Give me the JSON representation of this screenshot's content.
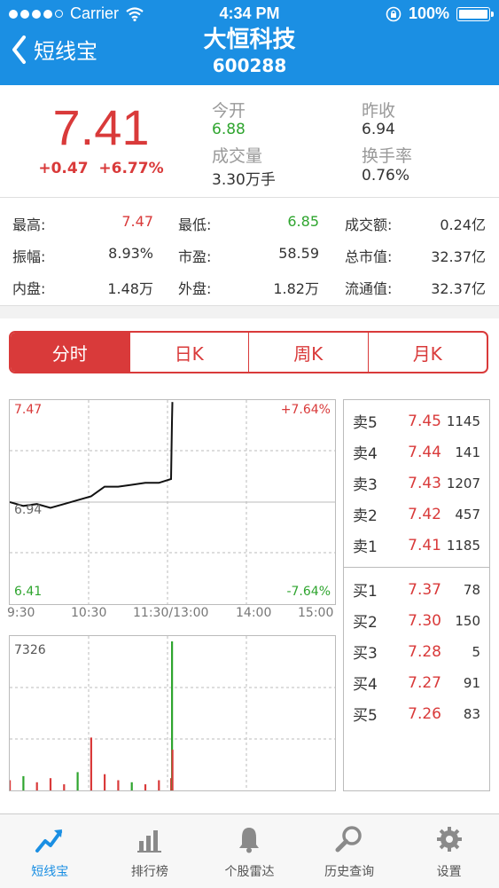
{
  "status": {
    "carrier": "Carrier",
    "time": "4:34 PM",
    "battery": "100%"
  },
  "nav": {
    "back_label": "短线宝",
    "title": "大恒科技",
    "code": "600288"
  },
  "quote": {
    "price": "7.41",
    "change": "+0.47",
    "change_pct": "+6.77%",
    "open_label": "今开",
    "open": "6.88",
    "prev_close_label": "昨收",
    "prev_close": "6.94",
    "volume_label": "成交量",
    "volume": "3.30万手",
    "turnover_label": "换手率",
    "turnover": "0.76%"
  },
  "stats": [
    [
      {
        "label": "最高:",
        "value": "7.47",
        "color": "red"
      },
      {
        "label": "最低:",
        "value": "6.85",
        "color": "green"
      },
      {
        "label": "成交额:",
        "value": "0.24亿",
        "color": ""
      }
    ],
    [
      {
        "label": "振幅:",
        "value": "8.93%",
        "color": ""
      },
      {
        "label": "市盈:",
        "value": "58.59",
        "color": ""
      },
      {
        "label": "总市值:",
        "value": "32.37亿",
        "color": ""
      }
    ],
    [
      {
        "label": "内盘:",
        "value": "1.48万",
        "color": ""
      },
      {
        "label": "外盘:",
        "value": "1.82万",
        "color": ""
      },
      {
        "label": "流通值:",
        "value": "32.37亿",
        "color": ""
      }
    ]
  ],
  "tabs": [
    {
      "label": "分时",
      "active": true
    },
    {
      "label": "日K",
      "active": false
    },
    {
      "label": "周K",
      "active": false
    },
    {
      "label": "月K",
      "active": false
    }
  ],
  "intraday": {
    "price_high": "7.47",
    "price_mid": "6.94",
    "price_low": "6.41",
    "pct_high": "+7.64%",
    "pct_low": "-7.64%",
    "times": [
      "9:30",
      "10:30",
      "11:30/13:00",
      "14:00",
      "15:00"
    ],
    "volume_max": "7326"
  },
  "chart_data": {
    "type": "line",
    "x": [
      "9:30",
      "9:40",
      "9:50",
      "10:00",
      "10:10",
      "10:20",
      "10:30",
      "10:40",
      "10:50",
      "11:00",
      "11:10",
      "11:20",
      "11:29",
      "11:30",
      "13:00"
    ],
    "series": [
      {
        "values": [
          6.94,
          6.92,
          6.93,
          6.91,
          6.93,
          6.95,
          6.97,
          7.02,
          7.02,
          7.03,
          7.04,
          7.04,
          7.06,
          7.35,
          7.46
        ]
      }
    ],
    "volume": [
      500,
      700,
      400,
      600,
      300,
      900,
      2600,
      800,
      500,
      400,
      300,
      500,
      600,
      7326,
      2000
    ],
    "ylim": [
      6.41,
      7.47
    ]
  },
  "order_book": {
    "sell": [
      {
        "label": "卖5",
        "price": "7.45",
        "vol": "1145"
      },
      {
        "label": "卖4",
        "price": "7.44",
        "vol": "141"
      },
      {
        "label": "卖3",
        "price": "7.43",
        "vol": "1207"
      },
      {
        "label": "卖2",
        "price": "7.42",
        "vol": "457"
      },
      {
        "label": "卖1",
        "price": "7.41",
        "vol": "1185"
      }
    ],
    "buy": [
      {
        "label": "买1",
        "price": "7.37",
        "vol": "78"
      },
      {
        "label": "买2",
        "price": "7.30",
        "vol": "150"
      },
      {
        "label": "买3",
        "price": "7.28",
        "vol": "5"
      },
      {
        "label": "买4",
        "price": "7.27",
        "vol": "91"
      },
      {
        "label": "买5",
        "price": "7.26",
        "vol": "83"
      }
    ]
  },
  "tabbar": [
    {
      "label": "短线宝",
      "icon": "trend-arrow-icon",
      "active": true
    },
    {
      "label": "排行榜",
      "icon": "bar-chart-icon",
      "active": false
    },
    {
      "label": "个股雷达",
      "icon": "bell-icon",
      "active": false
    },
    {
      "label": "历史查询",
      "icon": "search-icon",
      "active": false
    },
    {
      "label": "设置",
      "icon": "gear-icon",
      "active": false
    }
  ],
  "colors": {
    "brand": "#1b8fe3",
    "up": "#d93a3a",
    "down": "#2fa52f"
  }
}
